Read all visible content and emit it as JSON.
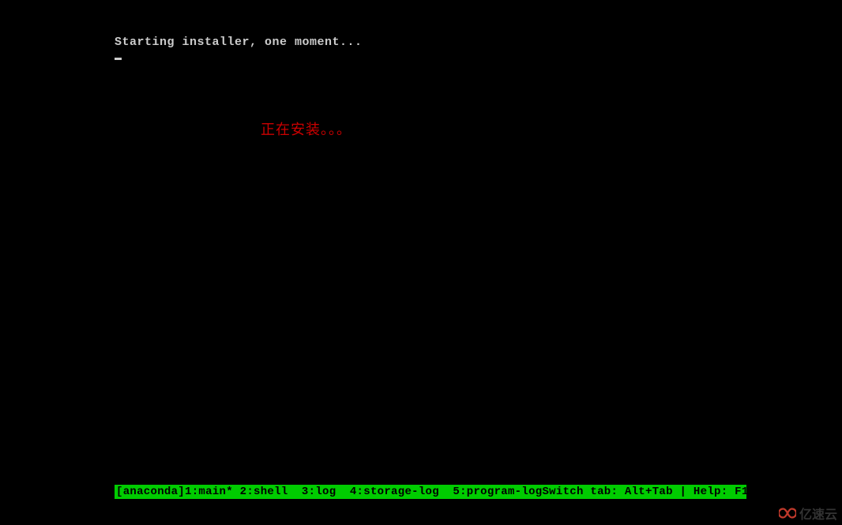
{
  "terminal": {
    "line1": "Starting installer, one moment..."
  },
  "annotation": {
    "text": "正在安装。。。"
  },
  "statusbar": {
    "session": "[anaconda]",
    "tabs": [
      {
        "index": "1",
        "label": "main",
        "active": true
      },
      {
        "index": "2",
        "label": "shell",
        "active": false
      },
      {
        "index": "3",
        "label": "log",
        "active": false
      },
      {
        "index": "4",
        "label": "storage-log",
        "active": false
      },
      {
        "index": "5",
        "label": "program-log",
        "active": false
      }
    ],
    "left_text": "[anaconda]1:main* 2:shell  3:log  4:storage-log  5:program-log",
    "right_text": "Switch tab: Alt+Tab | Help: F1"
  },
  "watermark": {
    "text": "亿速云"
  }
}
